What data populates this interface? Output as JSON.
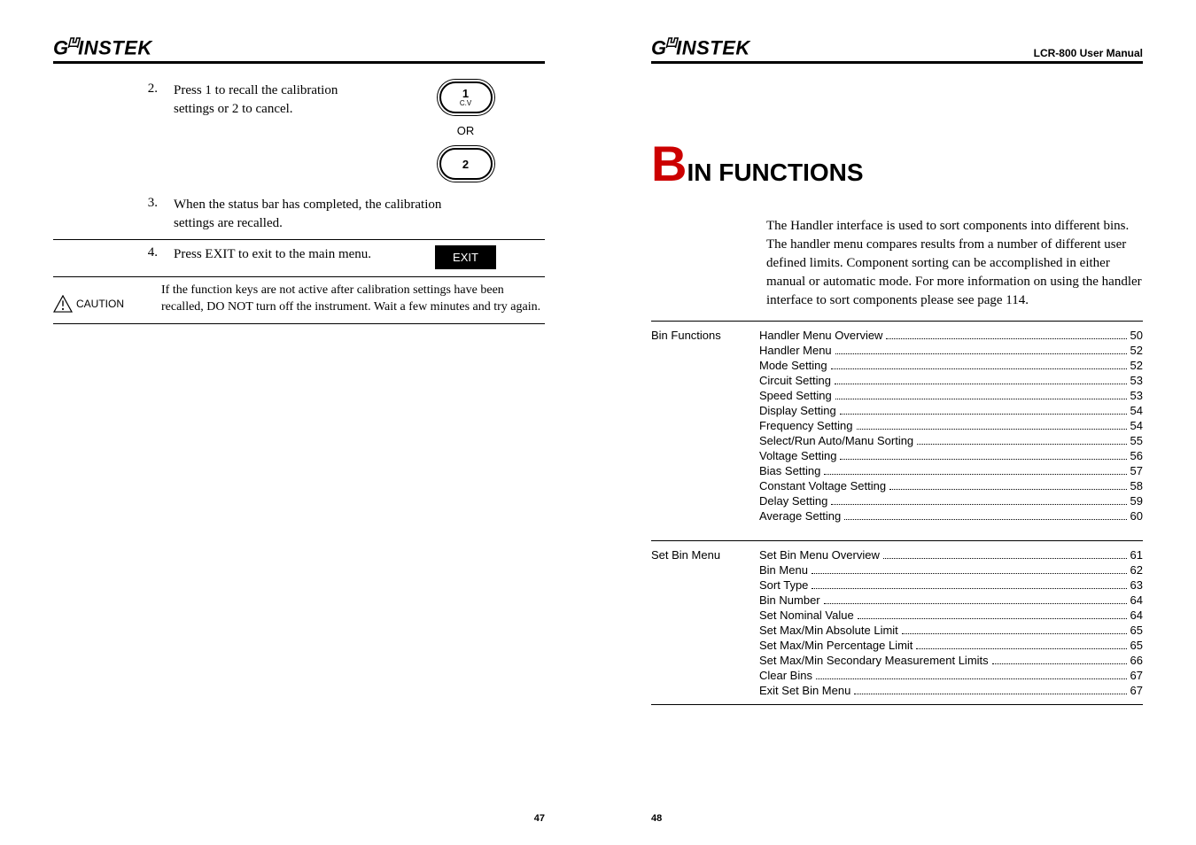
{
  "left": {
    "brand": "GWINSTEK",
    "steps": [
      {
        "num": "2.",
        "text": "Press 1 to recall the calibration settings or 2 to cancel."
      },
      {
        "num": "3.",
        "text": "When the status bar has completed, the calibration settings are recalled."
      },
      {
        "num": "4.",
        "text": "Press EXIT to exit to the main menu."
      }
    ],
    "key1": {
      "top": "1",
      "sub": "C.V"
    },
    "or": "OR",
    "key2": {
      "top": "2",
      "sub": ""
    },
    "exit_label": "EXIT",
    "caution_label": "CAUTION",
    "caution_text": "If the function keys are not active after calibration settings have been recalled, DO NOT turn off the instrument. Wait a few minutes and try again.",
    "page_num": "47"
  },
  "right": {
    "brand": "GWINSTEK",
    "manual_title": "LCR-800 User Manual",
    "chapter_b": "B",
    "chapter_rest": "IN FUNCTIONS",
    "intro": "The Handler interface is used to sort components into different bins. The handler menu compares results from a number of different user defined limits. Component sorting can be accomplished in either manual or automatic mode. For more information on using the handler interface to sort components please see page 114.",
    "sections": [
      {
        "label": "Bin Functions",
        "items": [
          {
            "title": "Handler Menu Overview",
            "page": "50"
          },
          {
            "title": "Handler Menu",
            "page": "52"
          },
          {
            "title": "Mode Setting",
            "page": "52"
          },
          {
            "title": "Circuit Setting",
            "page": "53"
          },
          {
            "title": "Speed Setting",
            "page": "53"
          },
          {
            "title": "Display Setting",
            "page": "54"
          },
          {
            "title": "Frequency Setting",
            "page": "54"
          },
          {
            "title": "Select/Run Auto/Manu Sorting",
            "page": "55"
          },
          {
            "title": "Voltage Setting",
            "page": "56"
          },
          {
            "title": "Bias Setting",
            "page": "57"
          },
          {
            "title": "Constant Voltage Setting",
            "page": "58"
          },
          {
            "title": "Delay Setting",
            "page": "59"
          },
          {
            "title": "Average Setting",
            "page": "60"
          }
        ]
      },
      {
        "label": "Set Bin Menu",
        "items": [
          {
            "title": "Set Bin Menu Overview",
            "page": "61"
          },
          {
            "title": "Bin Menu",
            "page": "62"
          },
          {
            "title": "Sort Type",
            "page": "63"
          },
          {
            "title": "Bin Number",
            "page": "64"
          },
          {
            "title": "Set Nominal Value",
            "page": "64"
          },
          {
            "title": "Set Max/Min Absolute Limit",
            "page": "65"
          },
          {
            "title": "Set Max/Min Percentage Limit",
            "page": "65"
          },
          {
            "title": "Set Max/Min Secondary Measurement Limits",
            "page": "66"
          },
          {
            "title": "Clear Bins",
            "page": "67"
          },
          {
            "title": "Exit Set Bin Menu",
            "page": "67"
          }
        ]
      }
    ],
    "page_num": "48"
  }
}
